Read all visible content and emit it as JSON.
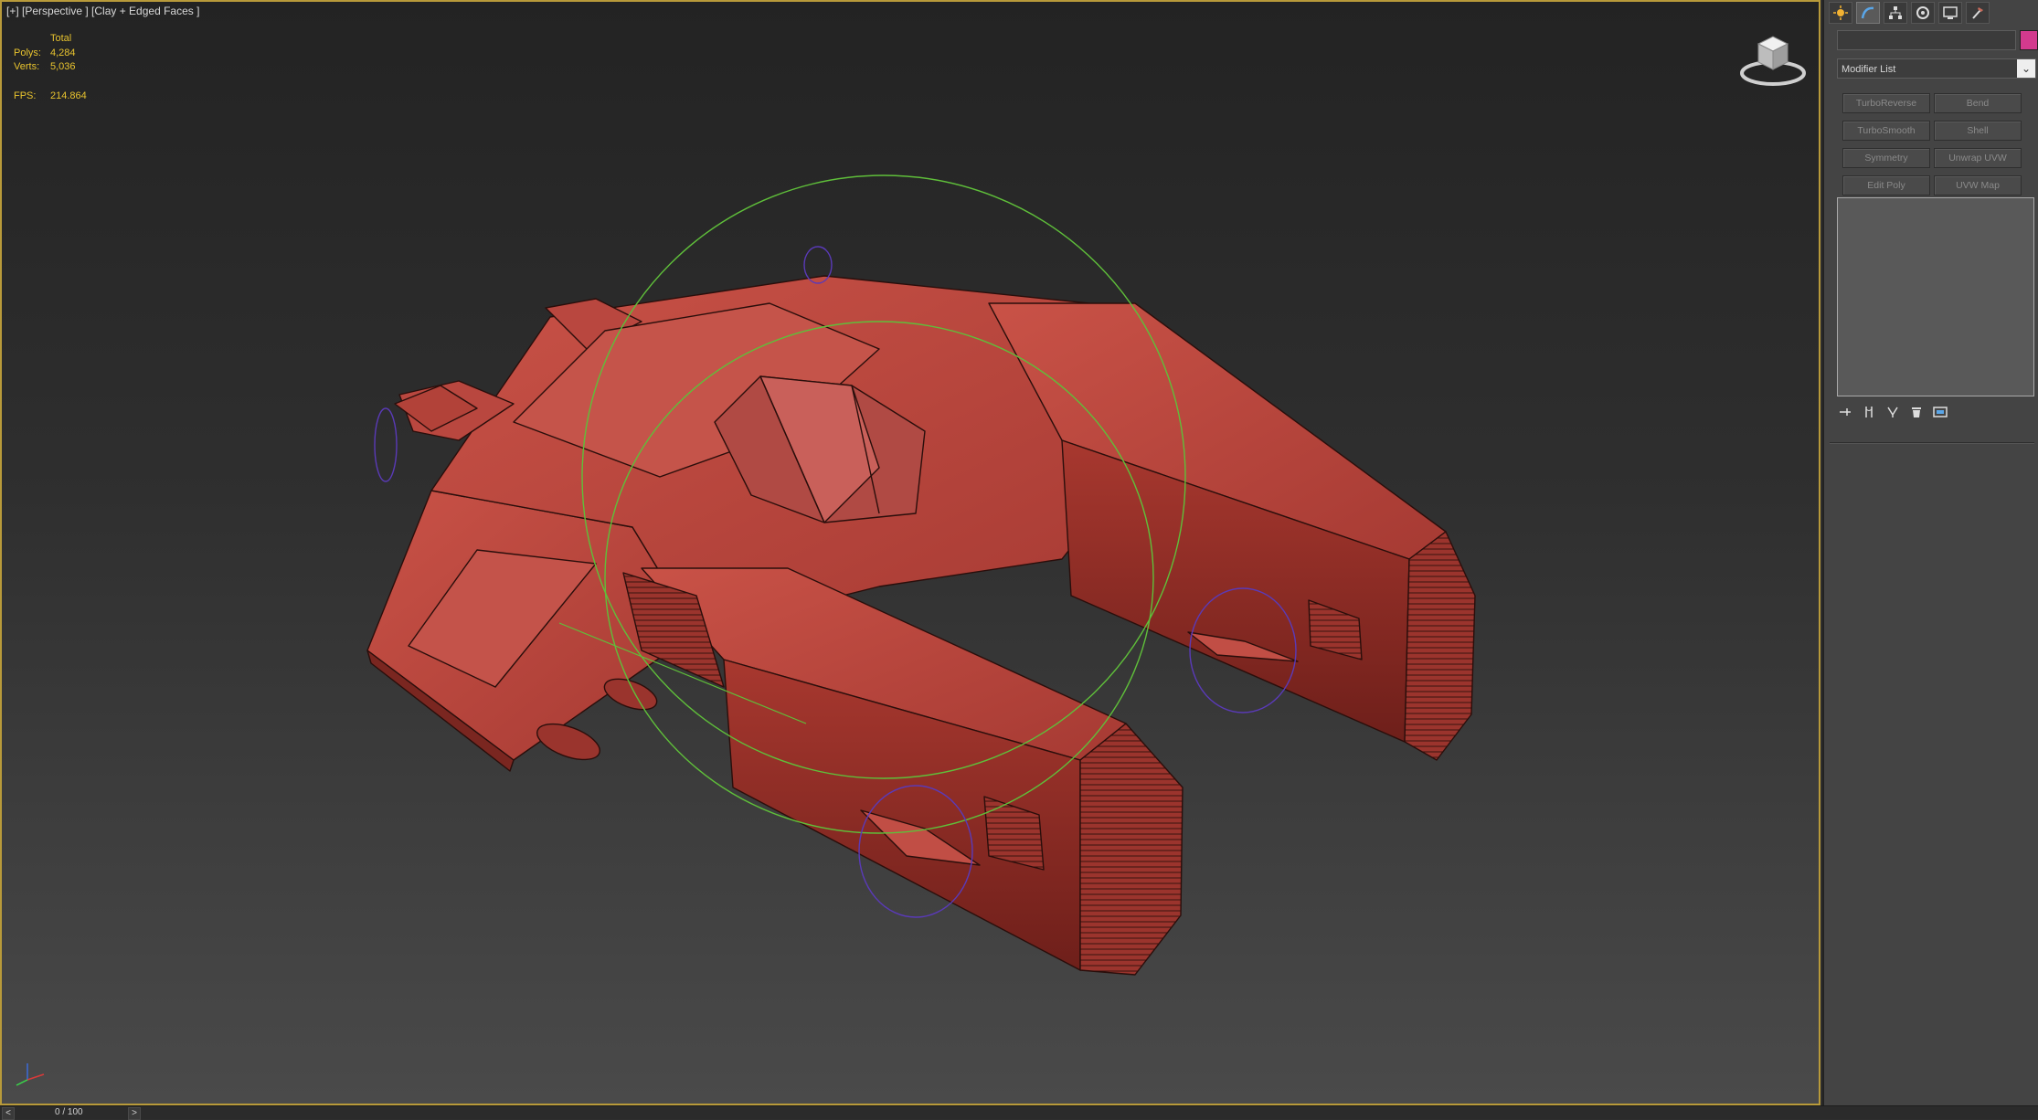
{
  "viewport": {
    "label": "[+] [Perspective ] [Clay + Edged Faces ]",
    "stats": {
      "header": "Total",
      "polys_label": "Polys:",
      "polys_value": "4,284",
      "verts_label": "Verts:",
      "verts_value": "5,036",
      "fps_label": "FPS:",
      "fps_value": "214.864"
    },
    "colors": {
      "stats_text": "#e8c32e",
      "frame_border": "#b89a3a",
      "model_fill": "#b9473f",
      "helper_circle": "#5fbf3a",
      "small_helper": "#5a3ab8"
    }
  },
  "timeline": {
    "prev": "<",
    "next": ">",
    "frame": "0 / 100"
  },
  "command_panel": {
    "tabs": [
      "create-tab",
      "modify-tab",
      "hierarchy-tab",
      "motion-tab",
      "display-tab",
      "utilities-tab"
    ],
    "active_tab": "modify-tab",
    "object_name": "",
    "object_color": "#d33a8e",
    "modifier_list": "Modifier List",
    "modifier_buttons": [
      "TurboReverse",
      "Bend",
      "TurboSmooth",
      "Shell",
      "Symmetry",
      "Unwrap UVW",
      "Edit Poly",
      "UVW Map"
    ]
  }
}
